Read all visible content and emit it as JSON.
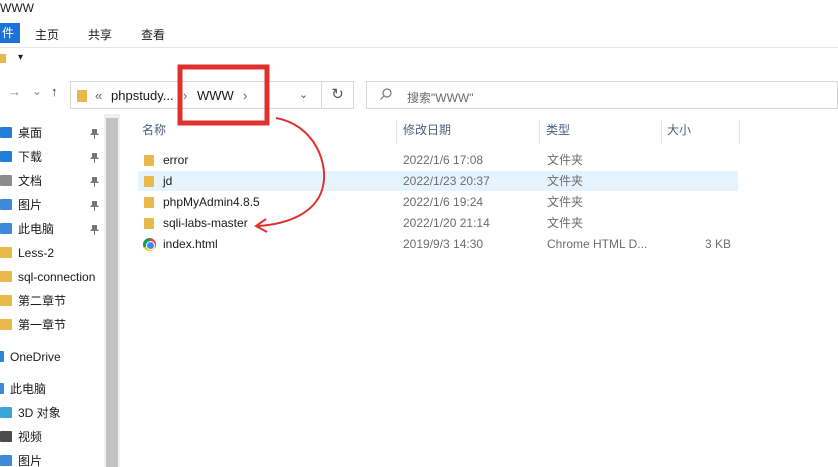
{
  "window": {
    "title": "WWW"
  },
  "ribbon": {
    "file_label": "件",
    "tabs": [
      "主页",
      "共享",
      "查看"
    ]
  },
  "qat": {
    "dropdown_glyph": "▾"
  },
  "nav": {
    "back_glyph": "→",
    "history_glyph": "⌄",
    "up_glyph": "↑",
    "breadcrumb": [
      "«",
      "phpstudy...",
      "›",
      "WWW",
      "›"
    ],
    "dropdown_glyph": "⌄",
    "refresh_glyph": "↻"
  },
  "search": {
    "icon": "search-icon",
    "placeholder": "搜索\"WWW\""
  },
  "sidebar": {
    "items": [
      {
        "label": "桌面",
        "icon": "desktop-icon",
        "pinned": true,
        "color": "#1f7fd6"
      },
      {
        "label": "下载",
        "icon": "download-icon",
        "pinned": true,
        "color": "#1f7fd6"
      },
      {
        "label": "文档",
        "icon": "document-icon",
        "pinned": true,
        "color": "#8c8c8c"
      },
      {
        "label": "图片",
        "icon": "picture-icon",
        "pinned": true,
        "color": "#3b8ad9"
      },
      {
        "label": "此电脑",
        "icon": "computer-icon",
        "pinned": true,
        "color": "#3b8ad9"
      },
      {
        "label": "Less-2",
        "icon": "folder-icon",
        "pinned": false,
        "color": "#e8b94a"
      },
      {
        "label": "sql-connection",
        "icon": "folder-icon",
        "pinned": false,
        "color": "#e8b94a"
      },
      {
        "label": "第二章节",
        "icon": "folder-icon",
        "pinned": false,
        "color": "#e8b94a"
      },
      {
        "label": "第一章节",
        "icon": "folder-icon",
        "pinned": false,
        "color": "#e8b94a"
      },
      {
        "label": "OneDrive",
        "icon": "onedrive-icon",
        "pinned": false,
        "color": "#2b88d8"
      },
      {
        "label": "此电脑",
        "icon": "computer-icon",
        "pinned": false,
        "color": "#3b8ad9"
      },
      {
        "label": "3D 对象",
        "icon": "cube-icon",
        "pinned": false,
        "color": "#38a7d8"
      },
      {
        "label": "视频",
        "icon": "video-icon",
        "pinned": false,
        "color": "#4b4b4b"
      },
      {
        "label": "图片",
        "icon": "picture-icon",
        "pinned": false,
        "color": "#3b8ad9"
      }
    ],
    "pin_glyph": "📌"
  },
  "list": {
    "headers": {
      "name": "名称",
      "date": "修改日期",
      "type": "类型",
      "size": "大小"
    },
    "rows": [
      {
        "name": "error",
        "date": "2022/1/6 17:08",
        "type": "文件夹",
        "size": "",
        "icon": "folder-icon",
        "selected": false
      },
      {
        "name": "jd",
        "date": "2022/1/23 20:37",
        "type": "文件夹",
        "size": "",
        "icon": "folder-icon",
        "selected": true
      },
      {
        "name": "phpMyAdmin4.8.5",
        "date": "2022/1/6 19:24",
        "type": "文件夹",
        "size": "",
        "icon": "folder-icon",
        "selected": false
      },
      {
        "name": "sqli-labs-master",
        "date": "2022/1/20 21:14",
        "type": "文件夹",
        "size": "",
        "icon": "folder-icon",
        "selected": false
      },
      {
        "name": "index.html",
        "date": "2019/9/3 14:30",
        "type": "Chrome HTML D...",
        "size": "3 KB",
        "icon": "chrome-icon",
        "selected": false
      }
    ]
  },
  "annotation": {
    "color": "#e03131"
  }
}
